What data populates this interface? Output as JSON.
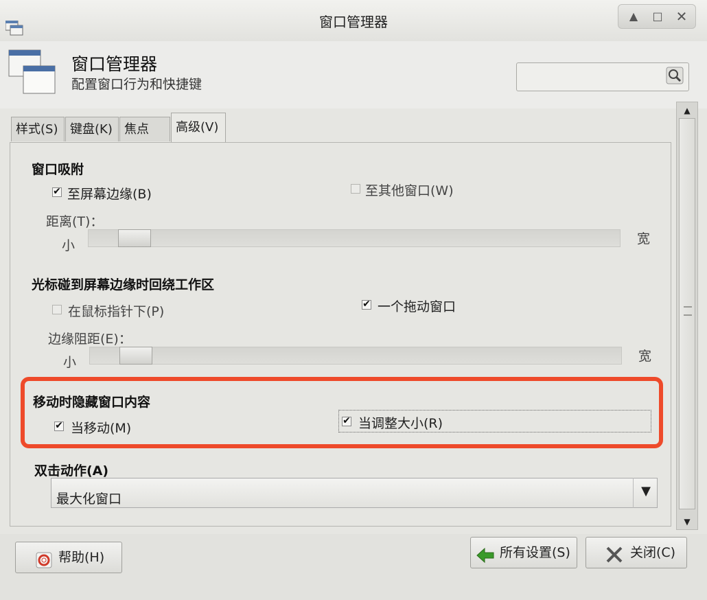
{
  "window": {
    "title": "窗口管理器"
  },
  "header": {
    "title": "窗口管理器",
    "subtitle": "配置窗口行为和快捷键",
    "search_placeholder": ""
  },
  "tabs": [
    {
      "label": "样式(S)"
    },
    {
      "label": "键盘(K)"
    },
    {
      "label": "焦点(F)"
    },
    {
      "label": "高级(V)"
    }
  ],
  "sections": {
    "snap": {
      "title": "窗口吸附",
      "to_screen_edge": {
        "label": "至屏幕边缘(B)",
        "checked": true
      },
      "to_other_windows": {
        "label": "至其他窗口(W)",
        "checked": false
      },
      "distance_label": "距离(T)：",
      "min_label": "小",
      "max_label": "宽",
      "slider_value": 0.06
    },
    "wrap": {
      "title": "光标碰到屏幕边缘时回绕工作区",
      "under_pointer": {
        "label": "在鼠标指针下(P)",
        "checked": false
      },
      "drag_window": {
        "label": "一个拖动窗口",
        "checked": true
      },
      "resistance_label": "边缘阻距(E)：",
      "min_label": "小",
      "max_label": "宽",
      "slider_value": 0.06
    },
    "hide": {
      "title": "移动时隐藏窗口内容",
      "when_moving": {
        "label": "当移动(M)",
        "checked": true
      },
      "when_resizing": {
        "label": "当调整大小(R)",
        "checked": true
      }
    },
    "double_click": {
      "title": "双击动作(A)",
      "selected": "最大化窗口"
    }
  },
  "buttons": {
    "help": "帮助(H)",
    "all_settings": "所有设置(S)",
    "close": "关闭(C)"
  },
  "colors": {
    "highlight": "#ee4a2a",
    "all_settings_icon": "#3a9a2a",
    "close_icon": "#555555",
    "help_icon": "#d03a2a"
  }
}
